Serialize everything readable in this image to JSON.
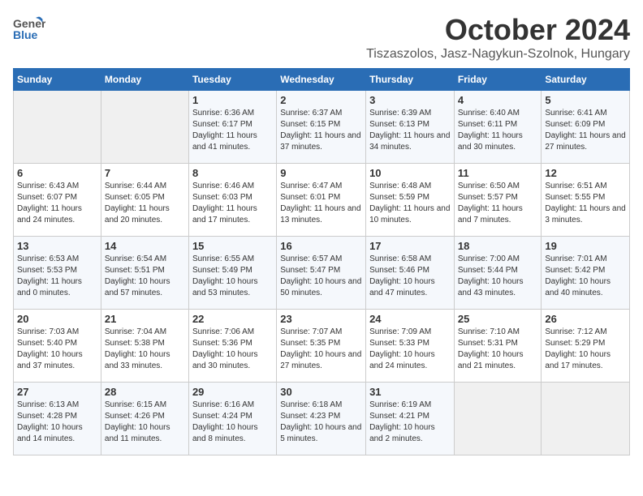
{
  "header": {
    "logo_general": "General",
    "logo_blue": "Blue",
    "month": "October 2024",
    "location": "Tiszaszolos, Jasz-Nagykun-Szolnok, Hungary"
  },
  "days_of_week": [
    "Sunday",
    "Monday",
    "Tuesday",
    "Wednesday",
    "Thursday",
    "Friday",
    "Saturday"
  ],
  "weeks": [
    [
      {
        "day": "",
        "sunrise": "",
        "sunset": "",
        "daylight": ""
      },
      {
        "day": "",
        "sunrise": "",
        "sunset": "",
        "daylight": ""
      },
      {
        "day": "1",
        "sunrise": "Sunrise: 6:36 AM",
        "sunset": "Sunset: 6:17 PM",
        "daylight": "Daylight: 11 hours and 41 minutes."
      },
      {
        "day": "2",
        "sunrise": "Sunrise: 6:37 AM",
        "sunset": "Sunset: 6:15 PM",
        "daylight": "Daylight: 11 hours and 37 minutes."
      },
      {
        "day": "3",
        "sunrise": "Sunrise: 6:39 AM",
        "sunset": "Sunset: 6:13 PM",
        "daylight": "Daylight: 11 hours and 34 minutes."
      },
      {
        "day": "4",
        "sunrise": "Sunrise: 6:40 AM",
        "sunset": "Sunset: 6:11 PM",
        "daylight": "Daylight: 11 hours and 30 minutes."
      },
      {
        "day": "5",
        "sunrise": "Sunrise: 6:41 AM",
        "sunset": "Sunset: 6:09 PM",
        "daylight": "Daylight: 11 hours and 27 minutes."
      }
    ],
    [
      {
        "day": "6",
        "sunrise": "Sunrise: 6:43 AM",
        "sunset": "Sunset: 6:07 PM",
        "daylight": "Daylight: 11 hours and 24 minutes."
      },
      {
        "day": "7",
        "sunrise": "Sunrise: 6:44 AM",
        "sunset": "Sunset: 6:05 PM",
        "daylight": "Daylight: 11 hours and 20 minutes."
      },
      {
        "day": "8",
        "sunrise": "Sunrise: 6:46 AM",
        "sunset": "Sunset: 6:03 PM",
        "daylight": "Daylight: 11 hours and 17 minutes."
      },
      {
        "day": "9",
        "sunrise": "Sunrise: 6:47 AM",
        "sunset": "Sunset: 6:01 PM",
        "daylight": "Daylight: 11 hours and 13 minutes."
      },
      {
        "day": "10",
        "sunrise": "Sunrise: 6:48 AM",
        "sunset": "Sunset: 5:59 PM",
        "daylight": "Daylight: 11 hours and 10 minutes."
      },
      {
        "day": "11",
        "sunrise": "Sunrise: 6:50 AM",
        "sunset": "Sunset: 5:57 PM",
        "daylight": "Daylight: 11 hours and 7 minutes."
      },
      {
        "day": "12",
        "sunrise": "Sunrise: 6:51 AM",
        "sunset": "Sunset: 5:55 PM",
        "daylight": "Daylight: 11 hours and 3 minutes."
      }
    ],
    [
      {
        "day": "13",
        "sunrise": "Sunrise: 6:53 AM",
        "sunset": "Sunset: 5:53 PM",
        "daylight": "Daylight: 11 hours and 0 minutes."
      },
      {
        "day": "14",
        "sunrise": "Sunrise: 6:54 AM",
        "sunset": "Sunset: 5:51 PM",
        "daylight": "Daylight: 10 hours and 57 minutes."
      },
      {
        "day": "15",
        "sunrise": "Sunrise: 6:55 AM",
        "sunset": "Sunset: 5:49 PM",
        "daylight": "Daylight: 10 hours and 53 minutes."
      },
      {
        "day": "16",
        "sunrise": "Sunrise: 6:57 AM",
        "sunset": "Sunset: 5:47 PM",
        "daylight": "Daylight: 10 hours and 50 minutes."
      },
      {
        "day": "17",
        "sunrise": "Sunrise: 6:58 AM",
        "sunset": "Sunset: 5:46 PM",
        "daylight": "Daylight: 10 hours and 47 minutes."
      },
      {
        "day": "18",
        "sunrise": "Sunrise: 7:00 AM",
        "sunset": "Sunset: 5:44 PM",
        "daylight": "Daylight: 10 hours and 43 minutes."
      },
      {
        "day": "19",
        "sunrise": "Sunrise: 7:01 AM",
        "sunset": "Sunset: 5:42 PM",
        "daylight": "Daylight: 10 hours and 40 minutes."
      }
    ],
    [
      {
        "day": "20",
        "sunrise": "Sunrise: 7:03 AM",
        "sunset": "Sunset: 5:40 PM",
        "daylight": "Daylight: 10 hours and 37 minutes."
      },
      {
        "day": "21",
        "sunrise": "Sunrise: 7:04 AM",
        "sunset": "Sunset: 5:38 PM",
        "daylight": "Daylight: 10 hours and 33 minutes."
      },
      {
        "day": "22",
        "sunrise": "Sunrise: 7:06 AM",
        "sunset": "Sunset: 5:36 PM",
        "daylight": "Daylight: 10 hours and 30 minutes."
      },
      {
        "day": "23",
        "sunrise": "Sunrise: 7:07 AM",
        "sunset": "Sunset: 5:35 PM",
        "daylight": "Daylight: 10 hours and 27 minutes."
      },
      {
        "day": "24",
        "sunrise": "Sunrise: 7:09 AM",
        "sunset": "Sunset: 5:33 PM",
        "daylight": "Daylight: 10 hours and 24 minutes."
      },
      {
        "day": "25",
        "sunrise": "Sunrise: 7:10 AM",
        "sunset": "Sunset: 5:31 PM",
        "daylight": "Daylight: 10 hours and 21 minutes."
      },
      {
        "day": "26",
        "sunrise": "Sunrise: 7:12 AM",
        "sunset": "Sunset: 5:29 PM",
        "daylight": "Daylight: 10 hours and 17 minutes."
      }
    ],
    [
      {
        "day": "27",
        "sunrise": "Sunrise: 6:13 AM",
        "sunset": "Sunset: 4:28 PM",
        "daylight": "Daylight: 10 hours and 14 minutes."
      },
      {
        "day": "28",
        "sunrise": "Sunrise: 6:15 AM",
        "sunset": "Sunset: 4:26 PM",
        "daylight": "Daylight: 10 hours and 11 minutes."
      },
      {
        "day": "29",
        "sunrise": "Sunrise: 6:16 AM",
        "sunset": "Sunset: 4:24 PM",
        "daylight": "Daylight: 10 hours and 8 minutes."
      },
      {
        "day": "30",
        "sunrise": "Sunrise: 6:18 AM",
        "sunset": "Sunset: 4:23 PM",
        "daylight": "Daylight: 10 hours and 5 minutes."
      },
      {
        "day": "31",
        "sunrise": "Sunrise: 6:19 AM",
        "sunset": "Sunset: 4:21 PM",
        "daylight": "Daylight: 10 hours and 2 minutes."
      },
      {
        "day": "",
        "sunrise": "",
        "sunset": "",
        "daylight": ""
      },
      {
        "day": "",
        "sunrise": "",
        "sunset": "",
        "daylight": ""
      }
    ]
  ]
}
